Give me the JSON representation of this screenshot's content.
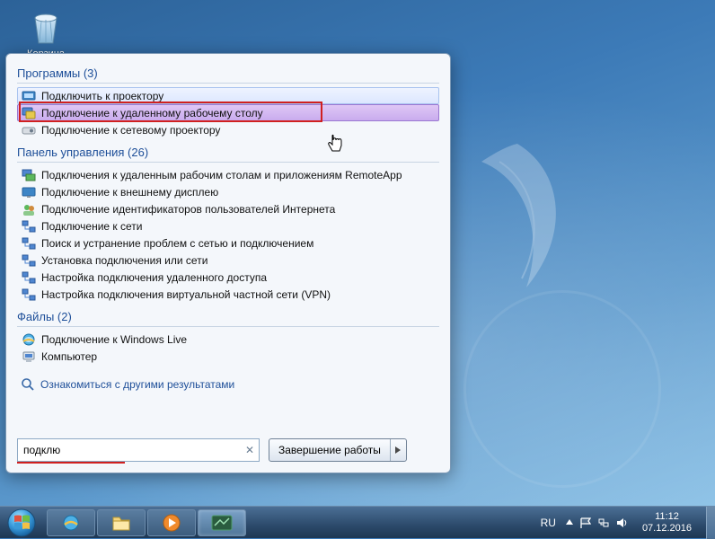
{
  "desktop": {
    "recycle_bin_label": "Корзина"
  },
  "start_menu": {
    "sections": {
      "programs": {
        "title": "Программы (3)",
        "items": [
          {
            "label": "Подключить к проектору",
            "icon": "projector-icon",
            "state": "hover"
          },
          {
            "label": "Подключение к удаленному рабочему столу",
            "icon": "rdp-icon",
            "state": "selected"
          },
          {
            "label": "Подключение к сетевому проектору",
            "icon": "network-projector-icon",
            "state": ""
          }
        ]
      },
      "control_panel": {
        "title": "Панель управления (26)",
        "items": [
          {
            "label": "Подключения к удаленным рабочим столам и приложениям RemoteApp",
            "icon": "remoteapp-icon"
          },
          {
            "label": "Подключение к внешнему дисплею",
            "icon": "display-icon"
          },
          {
            "label": "Подключение идентификаторов пользователей Интернета",
            "icon": "users-icon"
          },
          {
            "label": "Подключение к сети",
            "icon": "network-icon"
          },
          {
            "label": "Поиск и устранение проблем с сетью и подключением",
            "icon": "network-icon"
          },
          {
            "label": "Установка подключения или сети",
            "icon": "network-icon"
          },
          {
            "label": "Настройка подключения удаленного доступа",
            "icon": "network-icon"
          },
          {
            "label": "Настройка подключения виртуальной частной сети (VPN)",
            "icon": "network-icon"
          }
        ]
      },
      "files": {
        "title": "Файлы (2)",
        "items": [
          {
            "label": "Подключение к Windows Live",
            "icon": "ie-icon"
          },
          {
            "label": "Компьютер",
            "icon": "computer-icon"
          }
        ]
      }
    },
    "see_more": "Ознакомиться с другими результатами",
    "search_value": "подклю",
    "shutdown_label": "Завершение работы"
  },
  "taskbar": {
    "language": "RU",
    "time": "11:12",
    "date": "07.12.2016"
  }
}
